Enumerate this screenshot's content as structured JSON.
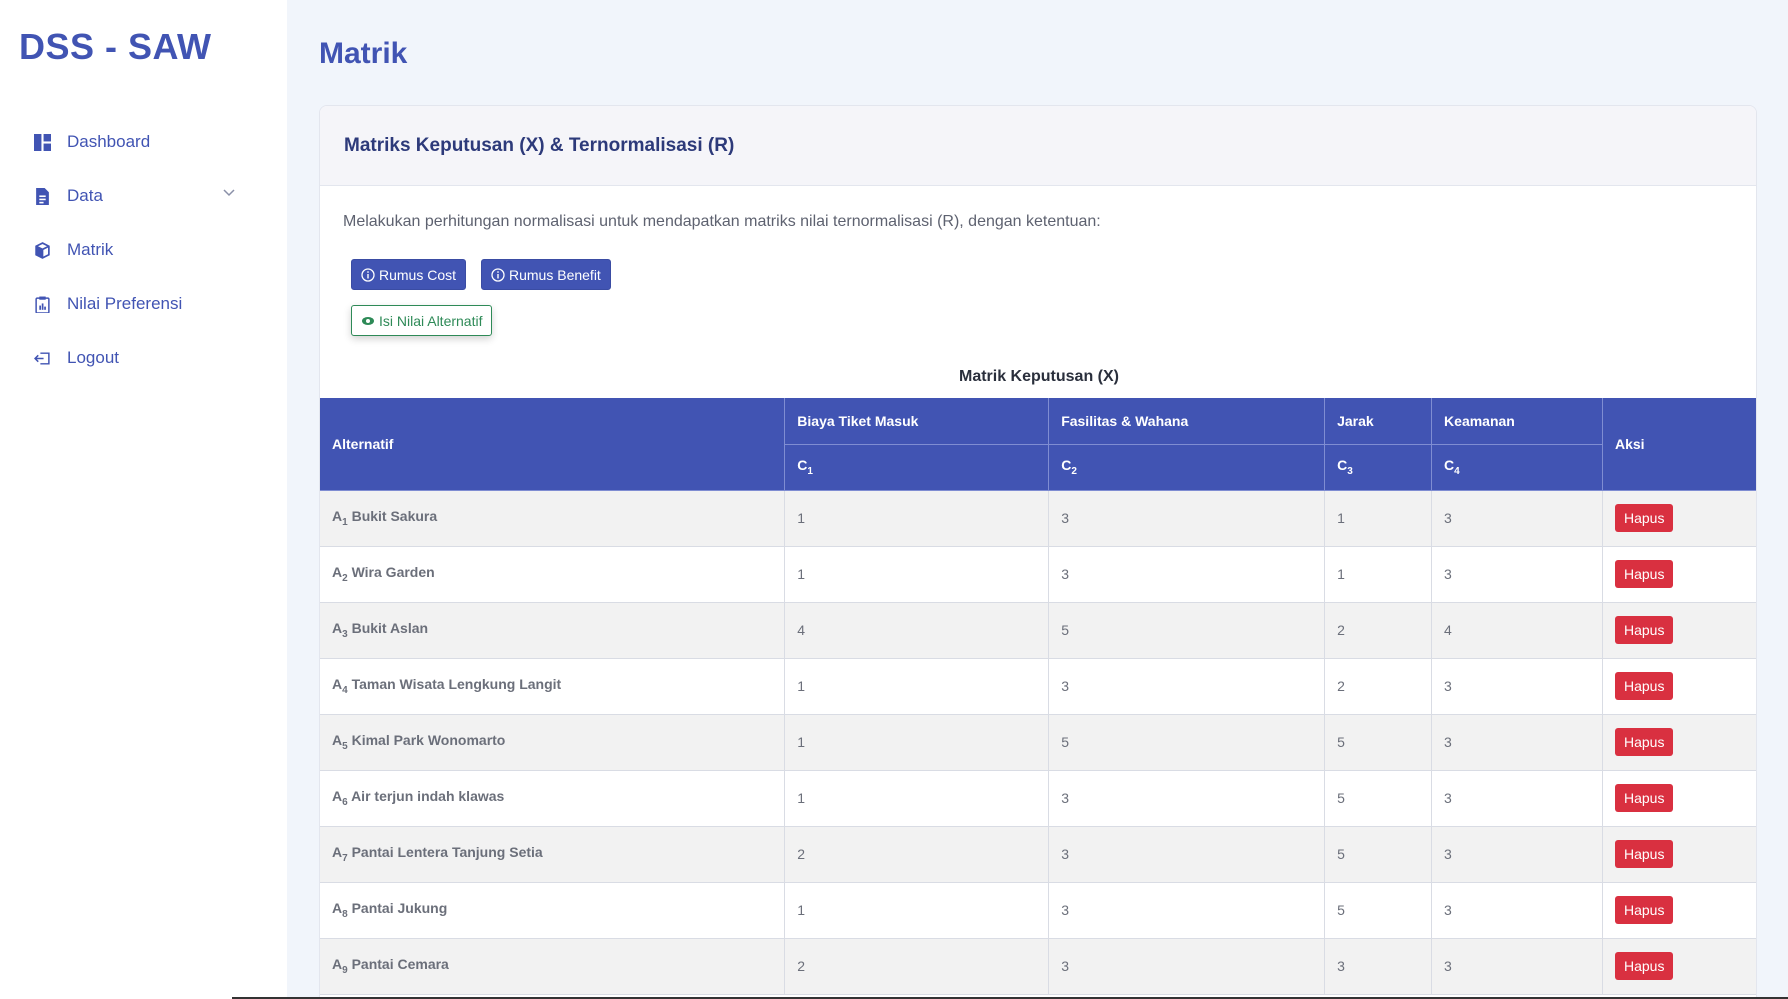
{
  "brand": "DSS - SAW",
  "sidebar": {
    "items": [
      {
        "label": "Dashboard",
        "icon": "dashboard-icon"
      },
      {
        "label": "Data",
        "icon": "document-icon",
        "has_submenu": true
      },
      {
        "label": "Matrik",
        "icon": "cube-icon"
      },
      {
        "label": "Nilai Preferensi",
        "icon": "clipboard-icon"
      },
      {
        "label": "Logout",
        "icon": "logout-icon"
      }
    ]
  },
  "page": {
    "title": "Matrik"
  },
  "card": {
    "title": "Matriks Keputusan (X) & Ternormalisasi (R)",
    "description": "Melakukan perhitungan normalisasi untuk mendapatkan matriks nilai ternormalisasi (R), dengan ketentuan:",
    "buttons": {
      "rumus_cost": "Rumus Cost",
      "rumus_benefit": "Rumus Benefit",
      "isi_nilai": "Isi Nilai Alternatif"
    }
  },
  "matrix": {
    "caption": "Matrik Keputusan (X)",
    "headers": {
      "alternatif": "Alternatif",
      "aksi": "Aksi",
      "criteria": [
        {
          "name": "Biaya Tiket Masuk",
          "code": "C",
          "sub": "1"
        },
        {
          "name": "Fasilitas & Wahana",
          "code": "C",
          "sub": "2"
        },
        {
          "name": "Jarak",
          "code": "C",
          "sub": "3"
        },
        {
          "name": "Keamanan",
          "code": "C",
          "sub": "4"
        }
      ]
    },
    "delete_label": "Hapus",
    "rows": [
      {
        "code": "A",
        "sub": "1",
        "name": "Bukit Sakura",
        "values": [
          "1",
          "3",
          "1",
          "3"
        ]
      },
      {
        "code": "A",
        "sub": "2",
        "name": "Wira Garden",
        "values": [
          "1",
          "3",
          "1",
          "3"
        ]
      },
      {
        "code": "A",
        "sub": "3",
        "name": "Bukit Aslan",
        "values": [
          "4",
          "5",
          "2",
          "4"
        ]
      },
      {
        "code": "A",
        "sub": "4",
        "name": "Taman Wisata Lengkung Langit",
        "values": [
          "1",
          "3",
          "2",
          "3"
        ]
      },
      {
        "code": "A",
        "sub": "5",
        "name": "Kimal Park Wonomarto",
        "values": [
          "1",
          "5",
          "5",
          "3"
        ]
      },
      {
        "code": "A",
        "sub": "6",
        "name": "Air terjun indah klawas",
        "values": [
          "1",
          "3",
          "5",
          "3"
        ]
      },
      {
        "code": "A",
        "sub": "7",
        "name": "Pantai Lentera Tanjung Setia",
        "values": [
          "2",
          "3",
          "5",
          "3"
        ]
      },
      {
        "code": "A",
        "sub": "8",
        "name": "Pantai Jukung",
        "values": [
          "1",
          "3",
          "5",
          "3"
        ]
      },
      {
        "code": "A",
        "sub": "9",
        "name": "Pantai Cemara",
        "values": [
          "2",
          "3",
          "3",
          "3"
        ]
      }
    ]
  },
  "colors": {
    "primary": "#4154b3",
    "danger": "#d93040",
    "success": "#2e8a57",
    "background": "#f1f5fb"
  }
}
